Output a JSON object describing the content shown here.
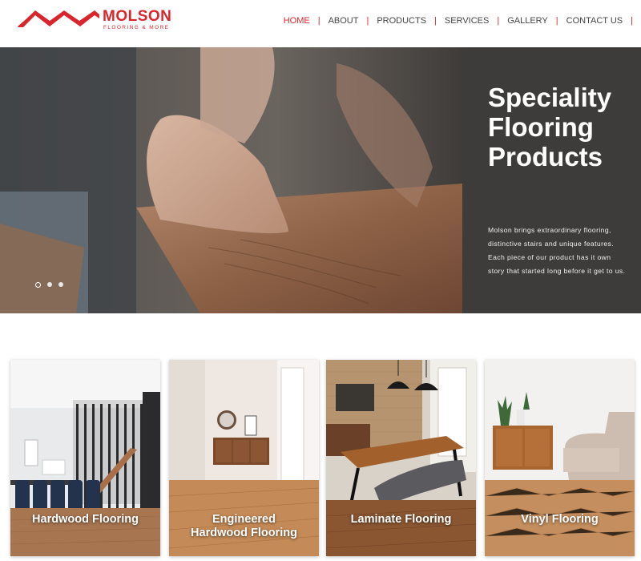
{
  "brand": {
    "name": "MOLSON",
    "tagline": "FLOORING & MORE",
    "color": "#d9262c"
  },
  "nav": {
    "items": [
      {
        "label": "HOME",
        "active": true
      },
      {
        "label": "ABOUT",
        "active": false
      },
      {
        "label": "PRODUCTS",
        "active": false
      },
      {
        "label": "SERVICES",
        "active": false
      },
      {
        "label": "GALLERY",
        "active": false
      },
      {
        "label": "CONTACT US",
        "active": false
      }
    ]
  },
  "hero": {
    "title_lines": [
      "Speciality",
      "Flooring",
      "Products"
    ],
    "text_lines": [
      "Molson brings extraordinary flooring,",
      "distinctive stairs and unique features.",
      "Each piece of our product has it own",
      "story that started long before it get to us."
    ],
    "slides": 3,
    "active_slide": 1
  },
  "cards": [
    {
      "label_lines": [
        "Hardwood Flooring"
      ],
      "scene": "dining-room-photo"
    },
    {
      "label_lines": [
        "Engineered",
        "Hardwood Flooring"
      ],
      "scene": "hallway-photo"
    },
    {
      "label_lines": [
        "Laminate Flooring"
      ],
      "scene": "dining-table-photo"
    },
    {
      "label_lines": [
        "Vinyl Flooring"
      ],
      "scene": "living-room-photo"
    }
  ]
}
